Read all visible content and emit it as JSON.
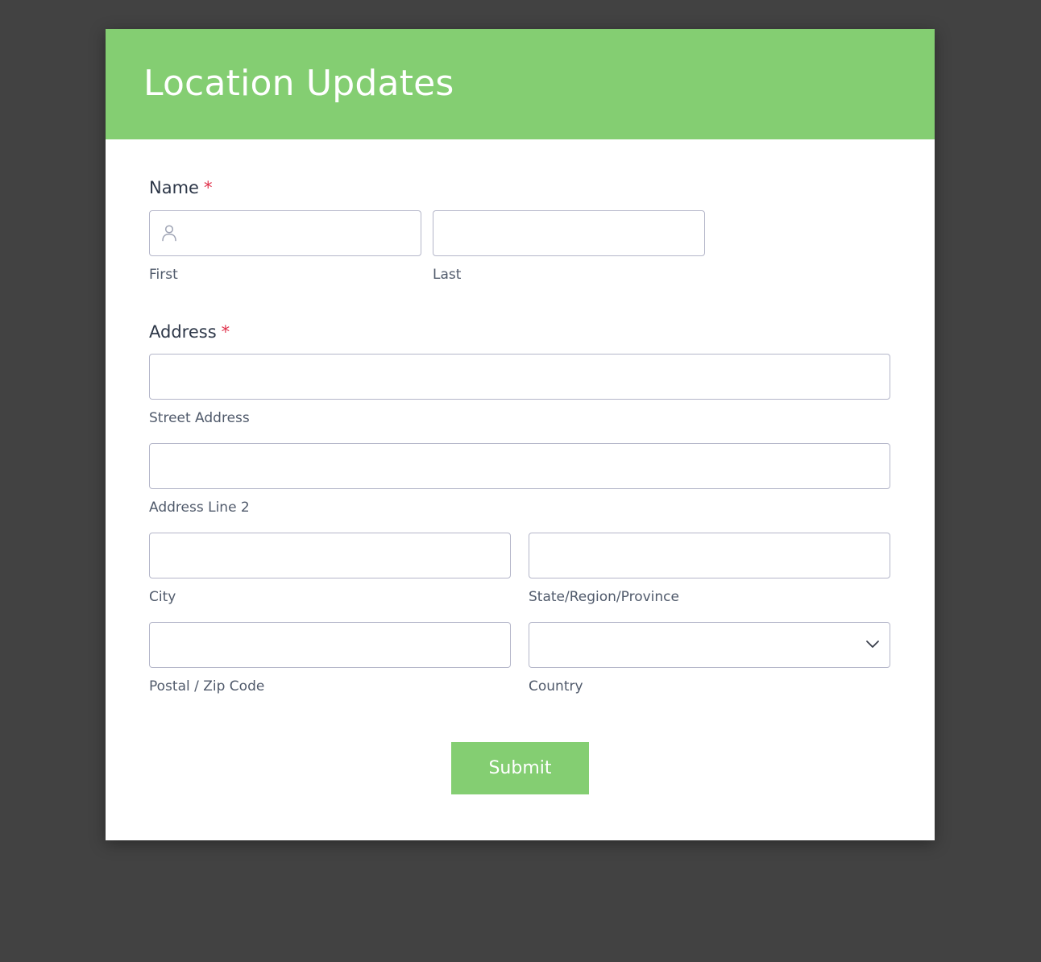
{
  "header": {
    "title": "Location Updates"
  },
  "name_field": {
    "label": "Name",
    "required_mark": "*",
    "first_sublabel": "First",
    "last_sublabel": "Last",
    "first_value": "",
    "last_value": ""
  },
  "address_field": {
    "label": "Address",
    "required_mark": "*",
    "street_sublabel": "Street Address",
    "line2_sublabel": "Address Line 2",
    "city_sublabel": "City",
    "state_sublabel": "State/Region/Province",
    "postal_sublabel": "Postal / Zip Code",
    "country_sublabel": "Country",
    "country_selected": ""
  },
  "icons": {
    "name_first": "person-icon",
    "country_select": "chevron-down-icon"
  },
  "submit": {
    "label": "Submit"
  },
  "colors": {
    "brand_green": "#84ce72",
    "required_red": "#e0314b",
    "page_background": "#424242",
    "input_border": "#b4b6c9"
  }
}
